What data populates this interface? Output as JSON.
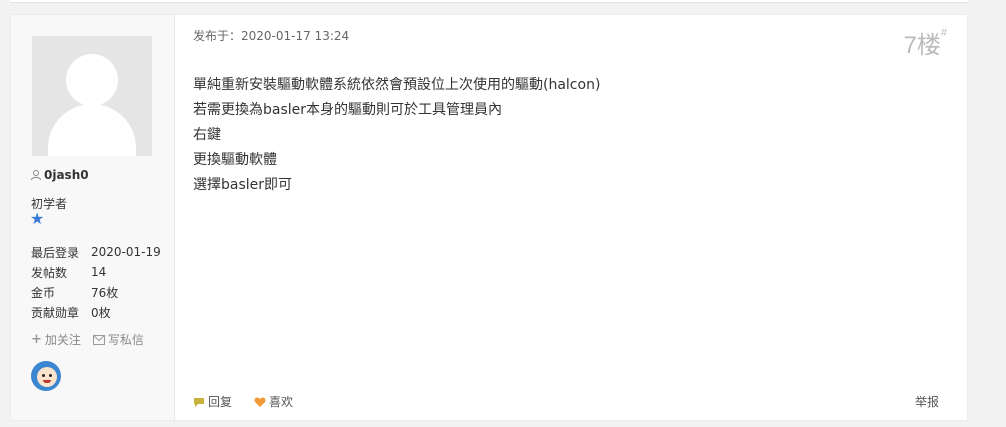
{
  "user": {
    "name": "0jash0",
    "rank": "初学者",
    "stats": [
      {
        "label": "最后登录",
        "value": "2020-01-19"
      },
      {
        "label": "发帖数",
        "value": "14"
      },
      {
        "label": "金币",
        "value": "76枚"
      },
      {
        "label": "贡献勋章",
        "value": "0枚"
      }
    ],
    "follow_label": "加关注",
    "message_label": "写私信"
  },
  "post": {
    "meta": "发布于：2020-01-17 13:24",
    "floor": "7楼",
    "floor_mark": "#",
    "lines": [
      "單純重新安裝驅動軟體系統依然會預設位上次使用的驅動(halcon)",
      "若需更換為basler本身的驅動則可於工具管理員內",
      "右鍵",
      "更換驅動軟體",
      "選擇basler即可"
    ],
    "reply_label": "回复",
    "like_label": "喜欢",
    "report_label": "举报"
  },
  "colors": {
    "star": "#3a7bd5",
    "reply_icon": "#c9b23c",
    "like_icon": "#f29a38"
  },
  "icons": [
    "user-icon",
    "star-icon",
    "plus-icon",
    "mail-icon",
    "reply-icon",
    "heart-icon",
    "medal-icon"
  ]
}
